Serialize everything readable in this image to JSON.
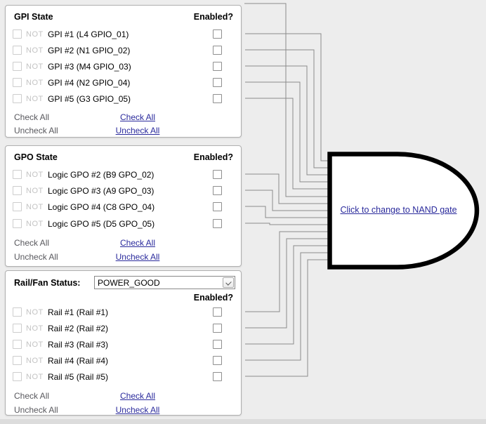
{
  "colors": {
    "background": "#ededed",
    "panel_background": "#ffffff",
    "panel_border": "#b0b0b0",
    "link": "#2a2a9c",
    "wire": "#8a8a8a",
    "gate_border": "#000000",
    "disabled_text": "#c3c3c3",
    "muted_text": "#58585d"
  },
  "panels": {
    "gpi": {
      "title": "GPI State",
      "enabled_header": "Enabled?",
      "not_label": "NOT",
      "rows": [
        "GPI #1 (L4 GPIO_01)",
        "GPI #2 (N1 GPIO_02)",
        "GPI #3 (M4 GPIO_03)",
        "GPI #4 (N2 GPIO_04)",
        "GPI #5 (G3 GPIO_05)"
      ],
      "check_all_muted": "Check All",
      "uncheck_all_muted": "Uncheck All",
      "check_all_link": "Check All",
      "uncheck_all_link": "Uncheck All"
    },
    "gpo": {
      "title": "GPO State",
      "enabled_header": "Enabled?",
      "not_label": "NOT",
      "rows": [
        "Logic GPO #2 (B9 GPO_02)",
        "Logic GPO #3 (A9 GPO_03)",
        "Logic GPO #4 (C8 GPO_04)",
        "Logic GPO #5 (D5 GPO_05)"
      ],
      "check_all_muted": "Check All",
      "uncheck_all_muted": "Uncheck All",
      "check_all_link": "Check All",
      "uncheck_all_link": "Uncheck All"
    },
    "rail": {
      "title": "Rail/Fan Status:",
      "dropdown_value": "POWER_GOOD",
      "enabled_header": "Enabled?",
      "not_label": "NOT",
      "rows": [
        "Rail #1 (Rail #1)",
        "Rail #2 (Rail #2)",
        "Rail #3 (Rail #3)",
        "Rail #4 (Rail #4)",
        "Rail #5 (Rail #5)"
      ],
      "check_all_muted": "Check All",
      "uncheck_all_muted": "Uncheck All",
      "check_all_link": "Check All",
      "uncheck_all_link": "Uncheck All"
    }
  },
  "gate": {
    "type": "AND",
    "link_label": "Click to change to NAND gate"
  }
}
